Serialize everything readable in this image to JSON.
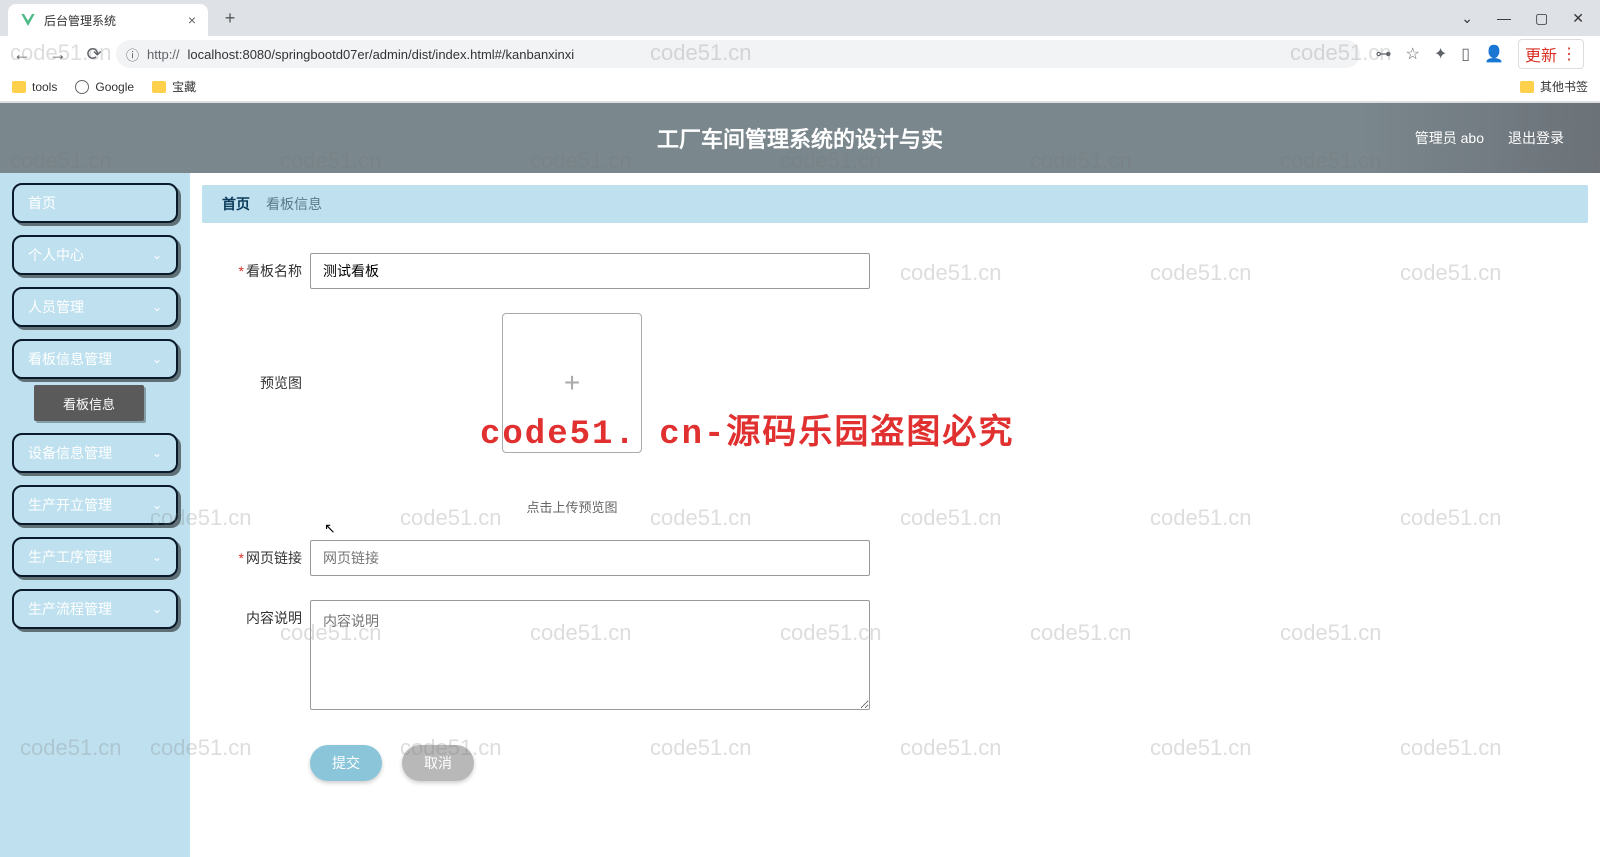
{
  "browser": {
    "tab_title": "后台管理系统",
    "url_display": "localhost:8080/springbootd07er/admin/dist/index.html#/kanbanxinxi",
    "url_prefix": "http://",
    "update_label": "更新",
    "bookmarks": {
      "tools": "tools",
      "google": "Google",
      "treasure": "宝藏",
      "other": "其他书签"
    }
  },
  "header": {
    "title": "工厂车间管理系统的设计与实",
    "user_label": "管理员 abo",
    "logout_label": "退出登录"
  },
  "sidebar": {
    "items": [
      {
        "label": "首页",
        "expandable": false
      },
      {
        "label": "个人中心",
        "expandable": true
      },
      {
        "label": "人员管理",
        "expandable": true
      },
      {
        "label": "看板信息管理",
        "expandable": true,
        "active_sub": "看板信息"
      },
      {
        "label": "设备信息管理",
        "expandable": true
      },
      {
        "label": "生产开立管理",
        "expandable": true
      },
      {
        "label": "生产工序管理",
        "expandable": true
      },
      {
        "label": "生产流程管理",
        "expandable": true
      }
    ]
  },
  "breadcrumb": {
    "home": "首页",
    "current": "看板信息"
  },
  "form": {
    "name_label": "看板名称",
    "name_value": "测试看板",
    "preview_label": "预览图",
    "upload_hint": "点击上传预览图",
    "link_label": "网页链接",
    "link_placeholder": "网页链接",
    "desc_label": "内容说明",
    "desc_placeholder": "内容说明",
    "submit_label": "提交",
    "cancel_label": "取消"
  },
  "watermark": {
    "text": "code51.cn",
    "red_text": "code51. cn-源码乐园盗图必究"
  }
}
